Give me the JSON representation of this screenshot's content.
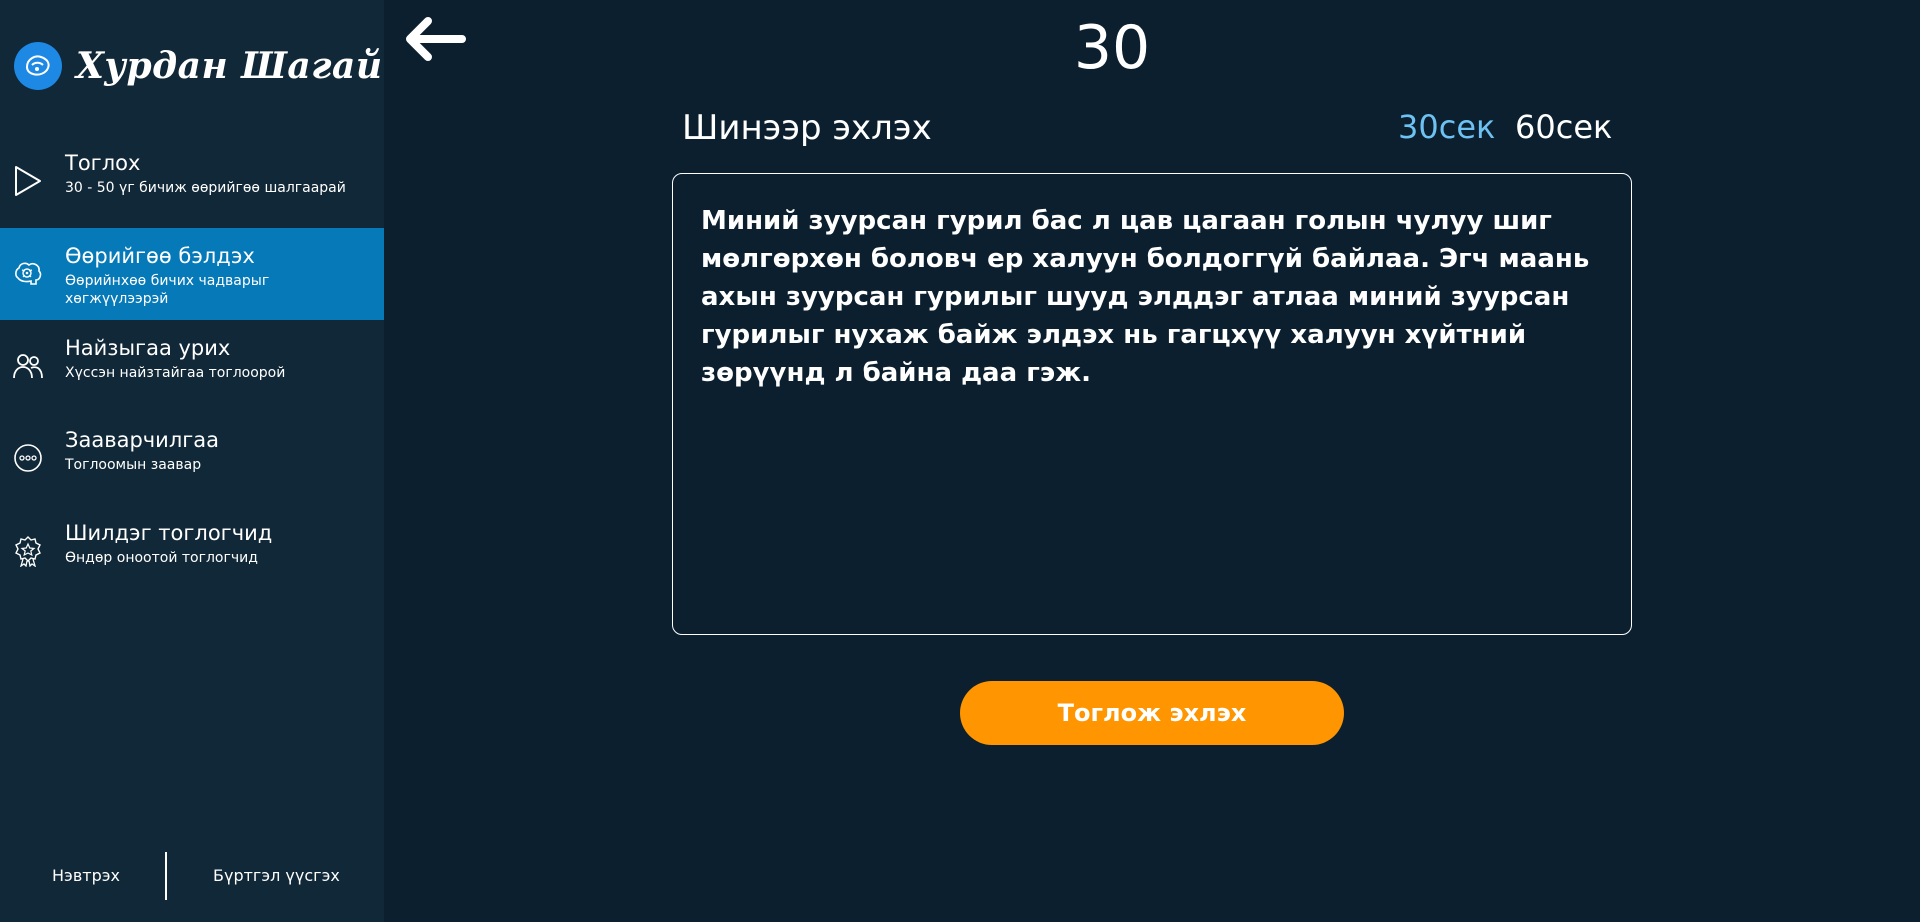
{
  "brand": {
    "name": "Хурдан Шагай",
    "logo_icon": "shagai-logo-icon"
  },
  "sidebar": {
    "items": [
      {
        "title": "Тоглох",
        "subtitle": "30 - 50 үг бичиж өөрийгөө шалгаарай",
        "icon": "play-icon",
        "active": false
      },
      {
        "title": "Өөрийгөө бэлдэх",
        "subtitle": "Өөрийнхөө бичих чадварыг хөгжүүлээрэй",
        "icon": "brain-icon",
        "active": true
      },
      {
        "title": "Найзыгаа урих",
        "subtitle": "Хүссэн найзтайгаа тоглоорой",
        "icon": "friends-icon",
        "active": false
      },
      {
        "title": "Зааварчилгаа",
        "subtitle": "Тоглоомын заавар",
        "icon": "dots-icon",
        "active": false
      },
      {
        "title": "Шилдэг тоглогчид",
        "subtitle": "Өндөр оноотой тоглогчид",
        "icon": "award-icon",
        "active": false
      }
    ],
    "login": "Нэвтрэх",
    "register": "Бүртгэл үүсгэх"
  },
  "main": {
    "timer": "30",
    "restart": "Шинээр эхлэх",
    "durations": [
      "30сек",
      "60сек"
    ],
    "selected_duration": "30сек",
    "passage": "Миний зуурсан гурил бас л цав цагаан голын чулуу шиг мөлгөрхөн боловч ер халуун болдоггүй байлаа. Эгч маань ахын зуурсан гурилыг шууд элддэг атлаа миний зуурсан гурилыг нухаж байж элдэх нь гагцхүү халуун хүйтний зөрүүнд л байна даа гэж.",
    "start_button": "Тоглож эхлэх"
  },
  "colors": {
    "background": "#0b1f2e",
    "sidebar": "#102837",
    "active_item": "#0679b8",
    "accent_button": "#ff9500",
    "selected_duration": "#6ec1f3"
  }
}
